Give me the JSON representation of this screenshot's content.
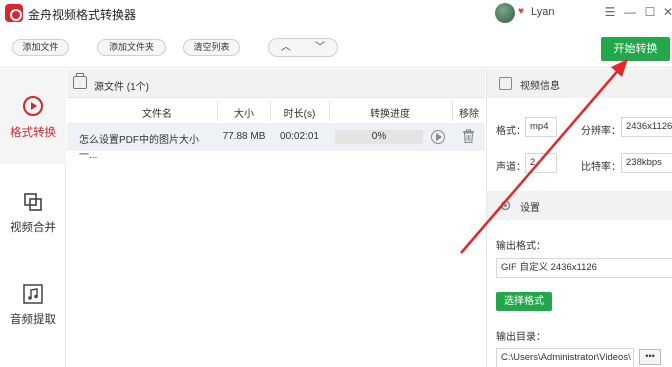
{
  "app": {
    "title": "金舟视频格式转换器"
  },
  "user": {
    "name": "Lyan"
  },
  "window_controls": {
    "menu": "☰",
    "minimize": "—",
    "maximize": "☐",
    "close": "✕"
  },
  "toolbar": {
    "add_file": "添加文件",
    "add_folder": "添加文件夹",
    "clear_list": "清空列表",
    "up_arrow": "︿",
    "down_arrow": "﹀",
    "start_convert": "开始转换"
  },
  "sidebar": {
    "items": [
      {
        "label": "格式转换",
        "active": true
      },
      {
        "label": "视频合并",
        "active": false
      },
      {
        "label": "音频提取",
        "active": false
      }
    ]
  },
  "file_list": {
    "header": "源文件 (1个)",
    "columns": [
      "文件名",
      "大小",
      "时长(s)",
      "转换进度",
      "移除"
    ],
    "rows": [
      {
        "name": "怎么设置PDF中的图片大小一...",
        "size": "77.88 MB",
        "duration": "00:02:01",
        "progress_text": "0%",
        "progress": 0
      }
    ]
  },
  "video_info": {
    "title": "视频信息",
    "format_label": "格式：",
    "format_value": "mp4",
    "resolution_label": "分辨率：",
    "resolution_value": "2436x1126",
    "channel_label": "声道：",
    "channel_value": "2",
    "bitrate_label": "比特率：",
    "bitrate_value": "238kbps"
  },
  "settings": {
    "title": "设置",
    "output_format_label": "输出格式：",
    "output_format_value": "GIF 自定义 2436x1126",
    "select_format_button": "选择格式",
    "output_dir_label": "输出目录：",
    "output_dir_value": "C:\\Users\\Administrator\\Videos\\",
    "more_button": "•••"
  },
  "colors": {
    "accent_green": "#22a84a",
    "brand_red": "#d9252b",
    "annotation_red": "#e5262a"
  }
}
